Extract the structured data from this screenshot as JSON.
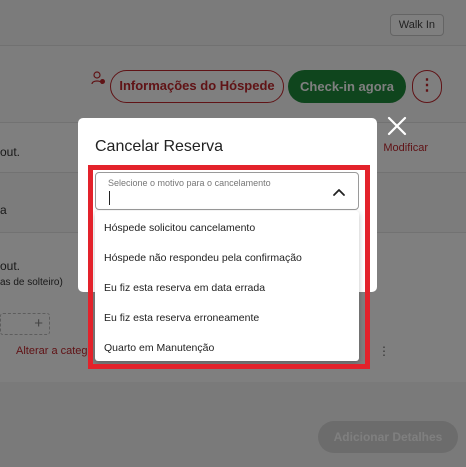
{
  "page": {
    "walkin_label": "Walk In",
    "guest_info_label": "Informações do Hóspede",
    "checkin_label": "Check-in agora",
    "more_label": "⋮"
  },
  "background": {
    "row1_text": "out.",
    "modify_label": "Modificar",
    "row2_text": "a",
    "row3_text": "out.",
    "row3_subtext": "as de solteiro)",
    "change_category_label": "Alterar a categ",
    "add_details_label": "Adicionar Detalhes"
  },
  "modal": {
    "title": "Cancelar Reserva",
    "select_placeholder": "Selecione o motivo para o cancelamento",
    "options": [
      "Hóspede solicitou cancelamento",
      "Hóspede não respondeu pela confirmação",
      "Eu fiz esta reserva em data errada",
      "Eu fiz esta reserva erroneamente",
      "Quarto em Manutenção"
    ]
  },
  "colors": {
    "accent_red": "#c0272d",
    "checkin_green": "#1e8a3a",
    "highlight_red": "#e3222b"
  }
}
